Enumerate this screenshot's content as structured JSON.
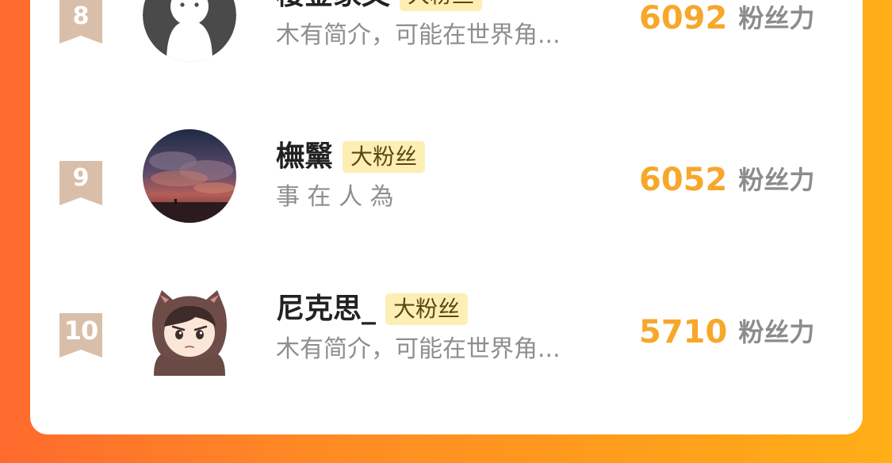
{
  "ranking": {
    "badge_label": "大粉丝",
    "score_unit": "粉丝力",
    "rows": [
      {
        "rank": "8",
        "name": "樱金家文",
        "bio": "木有简介，可能在世界角...",
        "score": "6092",
        "avatar": "default-avatar"
      },
      {
        "rank": "9",
        "name": "橅黳",
        "bio": "事 在 人 為",
        "score": "6052",
        "avatar": "sunset-clouds-avatar"
      },
      {
        "rank": "10",
        "name": "尼克思_",
        "bio": "木有简介，可能在世界角...",
        "score": "5710",
        "avatar": "hooded-cartoon-avatar"
      }
    ]
  },
  "colors": {
    "score": "#f7a72a",
    "badge_bg": "#fdefb4",
    "rank_ribbon": "#d9bfa9",
    "background_start": "#ff6a2e",
    "background_end": "#ffae17"
  }
}
